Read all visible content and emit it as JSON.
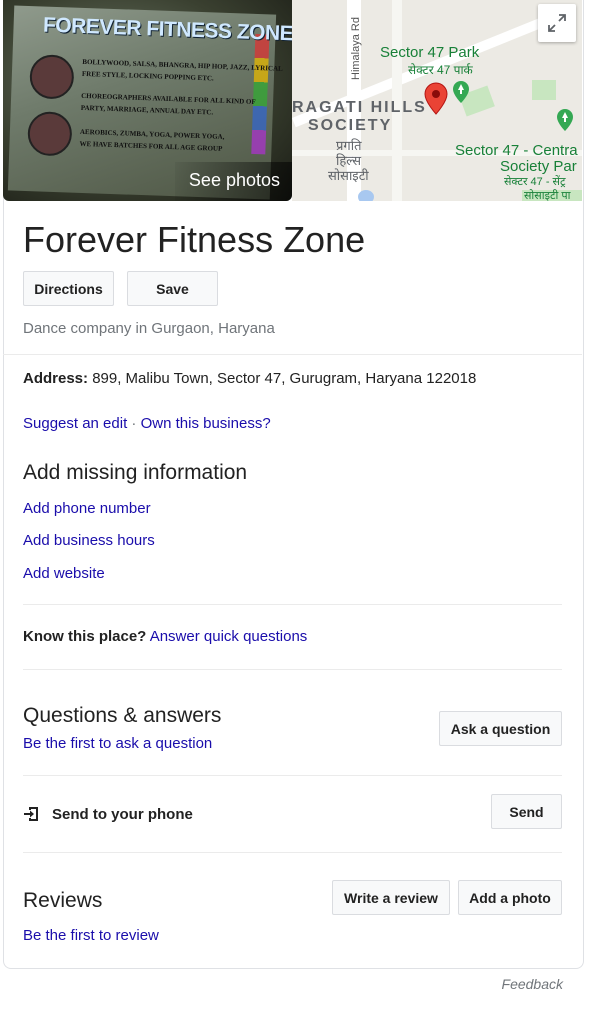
{
  "photo": {
    "poster_title": "FOREVER FITNESS ZONE",
    "poster_lines": [
      "BOLLYWOOD, SALSA, BHANGRA, HIP HOP, JAZZ, LYRICAL",
      "FREE STYLE, LOCKING POPPING ETC.",
      "CHOREOGRAPHERS AVAILABLE FOR ALL KIND OF",
      "PARTY, MARRIAGE, ANNUAL DAY ETC.",
      "AEROBICS, ZUMBA, YOGA, POWER YOGA,",
      "WE HAVE BATCHES FOR ALL AGE GROUP"
    ],
    "see_photos_label": "See photos"
  },
  "map": {
    "road_label": "Himalaya Rd",
    "labels": {
      "sector47_park_en": "Sector 47 Park",
      "sector47_park_hi": "सेक्टर 47 पार्क",
      "pragati_line1": "RAGATI HILLS",
      "pragati_line2": "SOCIETY",
      "pragati_hi1": "प्रगति",
      "pragati_hi2": "हिल्स",
      "pragati_hi3": "सोसाइटी",
      "central_en1": "Sector 47 - Centra",
      "central_en2": "Society Par",
      "central_hi1": "सेक्टर 47 - सेंट्र",
      "central_hi2": "सोसाइटी पा"
    },
    "pin_color": "#ea4335",
    "park_pin_color": "#34a853",
    "text_green": "#188038"
  },
  "business": {
    "name": "Forever Fitness Zone",
    "directions_label": "Directions",
    "save_label": "Save",
    "category": "Dance company in Gurgaon, Haryana"
  },
  "address": {
    "label": "Address:",
    "value": " 899, Malibu Town, Sector 47, Gurugram, Haryana 122018"
  },
  "edit_links": {
    "suggest_edit": "Suggest an edit",
    "separator": " · ",
    "own_business": "Own this business?"
  },
  "missing_info": {
    "heading": "Add missing information",
    "phone": "Add phone number",
    "hours": "Add business hours",
    "website": "Add website"
  },
  "know_place": {
    "label": "Know this place?",
    "link": "Answer quick questions"
  },
  "qa": {
    "heading": "Questions & answers",
    "first_link": "Be the first to ask a question",
    "ask_button": "Ask a question"
  },
  "send": {
    "label": "Send to your phone",
    "button": "Send"
  },
  "reviews": {
    "heading": "Reviews",
    "first_link": "Be the first to review",
    "write_button": "Write a review",
    "photo_button": "Add a photo"
  },
  "footer": {
    "feedback": "Feedback"
  },
  "colors": {
    "link": "#1a0dab",
    "subtle_text": "#70757a",
    "border": "#dfe1e5"
  }
}
